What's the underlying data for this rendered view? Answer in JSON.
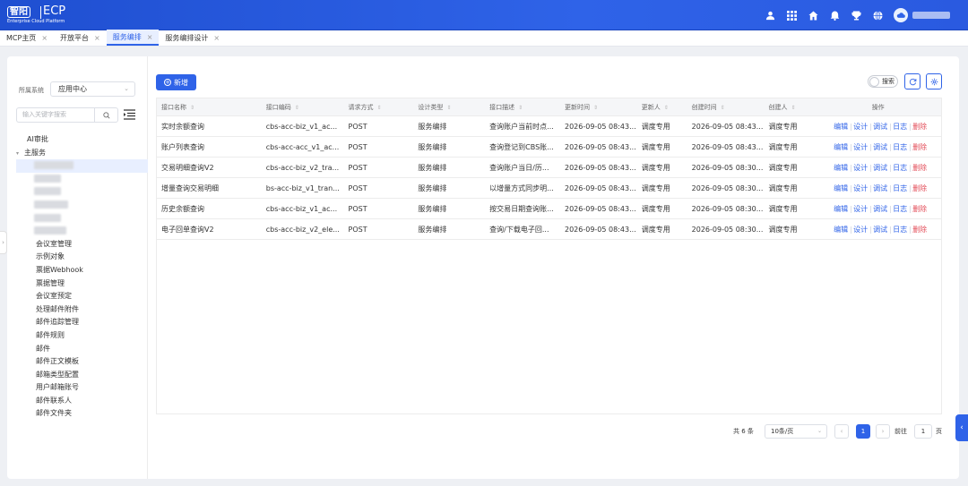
{
  "header": {
    "logo_mark": "智阳",
    "title": "ECP",
    "subtitle": "Enterprise Cloud Platform",
    "icons": [
      "user-icon",
      "grid-icon",
      "home-icon",
      "bell-icon",
      "trophy-icon",
      "globe-icon"
    ]
  },
  "tabs": [
    {
      "label": "MCP主页",
      "active": false
    },
    {
      "label": "开放平台",
      "active": false
    },
    {
      "label": "服务编排",
      "active": true
    },
    {
      "label": "服务编排设计",
      "active": false
    }
  ],
  "sidebar": {
    "system_label": "所属系统",
    "system_value": "应用中心",
    "search_placeholder": "输入关键字搜索",
    "tree_top": "AI审批",
    "tree_parent": "主服务",
    "tree_items": [
      "会议室管理",
      "示例对象",
      "票据Webhook",
      "票据管理",
      "会议室预定",
      "处理邮件附件",
      "邮件追踪管理",
      "邮件规则",
      "邮件",
      "邮件正文模板",
      "邮箱类型配置",
      "用户邮箱账号",
      "邮件联系人",
      "邮件文件夹"
    ]
  },
  "toolbar": {
    "add_label": "新增",
    "search_toggle_label": "搜索"
  },
  "table": {
    "headers": [
      "接口名称",
      "接口编码",
      "请求方式",
      "设计类型",
      "接口描述",
      "更新时间",
      "更新人",
      "创建时间",
      "创建人",
      "操作"
    ],
    "rows": [
      [
        "实时余额查询",
        "cbs-acc-biz_v1_ac...",
        "POST",
        "服务编排",
        "查询账户当前时点...",
        "2026-09-05 08:43...",
        "调度专用",
        "2026-09-05 08:43...",
        "调度专用"
      ],
      [
        "账户列表查询",
        "cbs-acc-acc_v1_ac...",
        "POST",
        "服务编排",
        "查询登记到CBS账...",
        "2026-09-05 08:43...",
        "调度专用",
        "2026-09-05 08:43...",
        "调度专用"
      ],
      [
        "交易明细查询V2",
        "cbs-acc-biz_v2_tra...",
        "POST",
        "服务编排",
        "查询账户当日/历...",
        "2026-09-05 08:43...",
        "调度专用",
        "2026-09-05 08:30...",
        "调度专用"
      ],
      [
        "增量查询交易明细",
        "bs-acc-biz_v1_tran...",
        "POST",
        "服务编排",
        "以增量方式同步明...",
        "2026-09-05 08:43...",
        "调度专用",
        "2026-09-05 08:30...",
        "调度专用"
      ],
      [
        "历史余额查询",
        "cbs-acc-biz_v1_ac...",
        "POST",
        "服务编排",
        "按交易日期查询账...",
        "2026-09-05 08:43...",
        "调度专用",
        "2026-09-05 08:30...",
        "调度专用"
      ],
      [
        "电子回单查询V2",
        "cbs-acc-biz_v2_ele...",
        "POST",
        "服务编排",
        "查询/下载电子回...",
        "2026-09-05 08:43...",
        "调度专用",
        "2026-09-05 08:30...",
        "调度专用"
      ]
    ],
    "actions": [
      "编辑",
      "设计",
      "调试",
      "日志",
      "删除"
    ]
  },
  "pagination": {
    "total_text": "共 6 条",
    "page_size": "10条/页",
    "current_page": "1",
    "goto_label": "前往",
    "goto_value": "1",
    "page_unit": "页"
  },
  "colors": {
    "primary": "#2f63e8",
    "danger": "#e34d59"
  }
}
